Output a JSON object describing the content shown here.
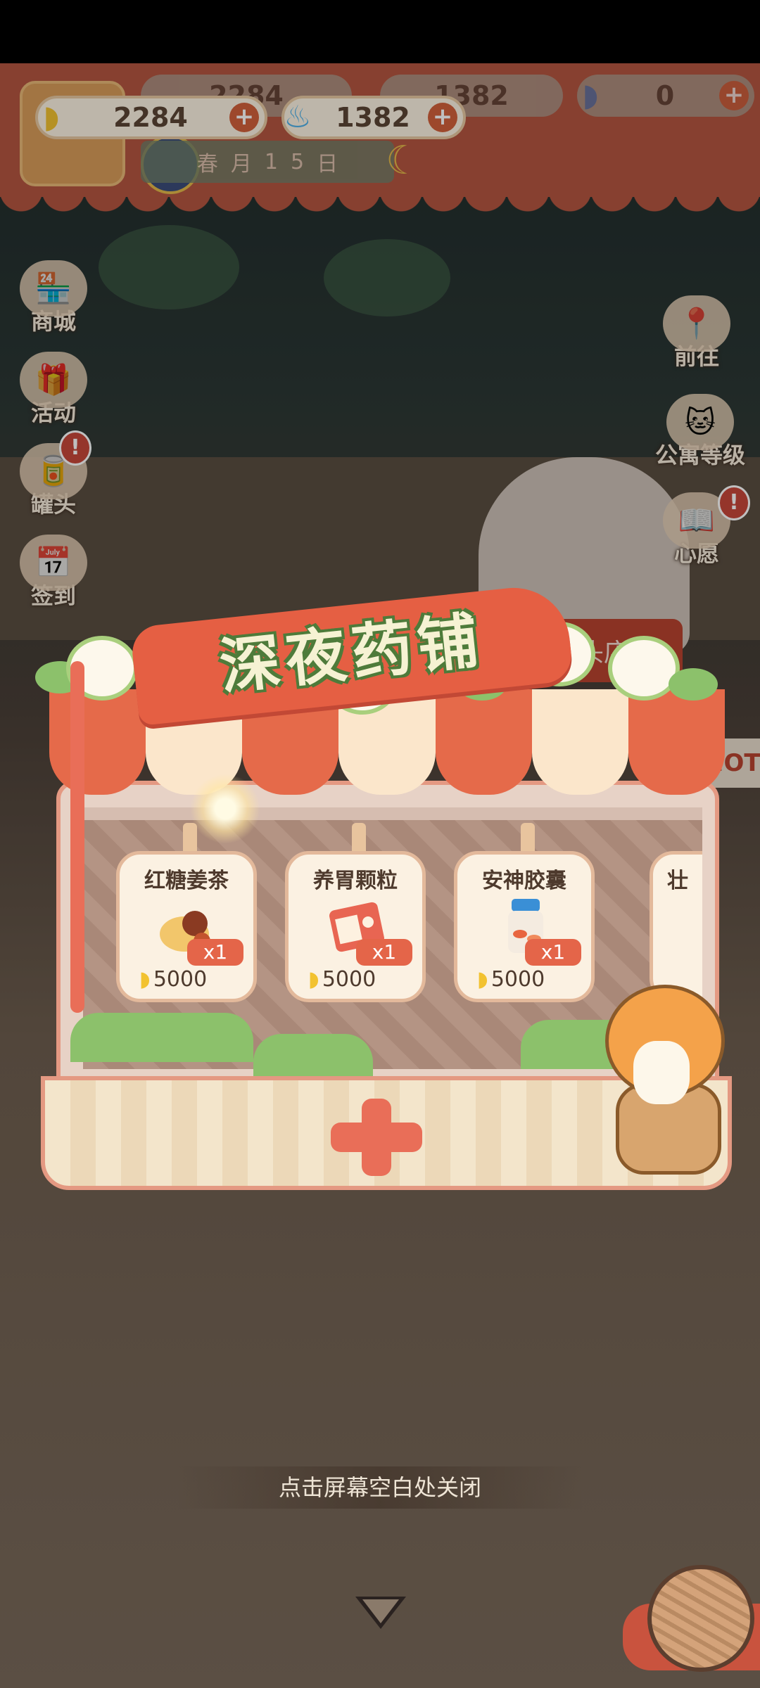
{
  "resources": {
    "banana": {
      "value": "2284",
      "icon": "banana-icon"
    },
    "flame": {
      "value": "1382",
      "icon": "blue-flame-icon"
    },
    "background_pills": [
      {
        "value": "2284"
      },
      {
        "value": "1382"
      },
      {
        "value": "0"
      }
    ]
  },
  "date": {
    "season": "春",
    "month_label": "月",
    "day": "1",
    "day2": "5",
    "day_label": "日"
  },
  "left_menu": [
    {
      "label": "商城",
      "icon": "shop-icon"
    },
    {
      "label": "活动",
      "icon": "gift-icon"
    },
    {
      "label": "罐头",
      "icon": "can-icon",
      "alert": "!"
    },
    {
      "label": "签到",
      "icon": "calendar-icon"
    }
  ],
  "right_menu": [
    {
      "label": "前往",
      "icon": "map-icon"
    },
    {
      "label": "公寓等级",
      "icon": "apartment-level-icon"
    },
    {
      "label": "心愿",
      "icon": "wish-book-icon",
      "alert": "!"
    }
  ],
  "scene": {
    "store_sign": "罐头店",
    "hot_sign": "HOT"
  },
  "popup": {
    "title": "深夜药铺",
    "items": [
      {
        "name": "红糖姜茶",
        "qty": "x1",
        "price": "5000",
        "icon": "ginger-tea-icon"
      },
      {
        "name": "养胃颗粒",
        "qty": "x1",
        "price": "5000",
        "icon": "stomach-granules-icon"
      },
      {
        "name": "安神胶囊",
        "qty": "x1",
        "price": "5000",
        "icon": "capsule-bottle-icon"
      },
      {
        "name": "壮",
        "qty": "",
        "price": "",
        "icon": "partial-item-icon"
      }
    ]
  },
  "hint": "点击屏幕空白处关闭",
  "colors": {
    "accent": "#e55f43",
    "title_text": "#f6f2d3",
    "title_outline": "#4e7b3a"
  }
}
